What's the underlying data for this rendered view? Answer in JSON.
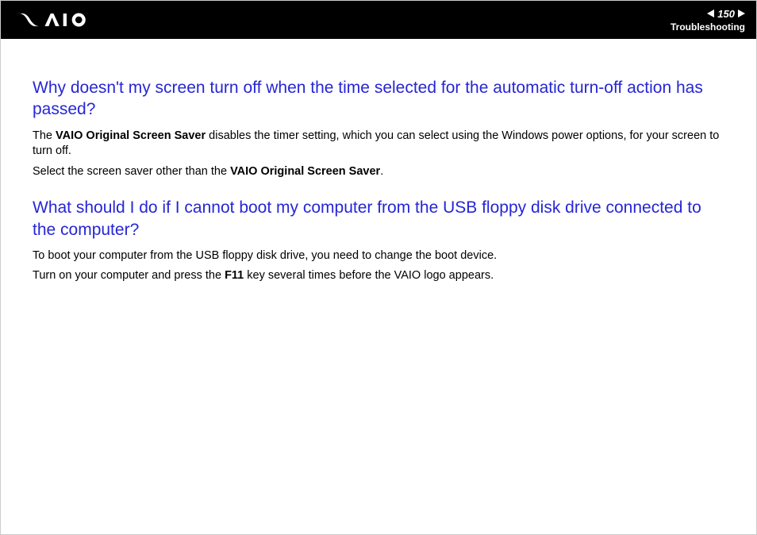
{
  "header": {
    "page_number": "150",
    "section": "Troubleshooting"
  },
  "q1": {
    "title": "Why doesn't my screen turn off when the time selected for the automatic turn-off action has passed?",
    "p1_a": "The ",
    "p1_b": "VAIO Original Screen Saver",
    "p1_c": " disables the timer setting, which you can select using the Windows power options, for your screen to turn off.",
    "p2_a": "Select the screen saver other than the ",
    "p2_b": "VAIO Original Screen Saver",
    "p2_c": "."
  },
  "q2": {
    "title": "What should I do if I cannot boot my computer from the USB floppy disk drive connected to the computer?",
    "p1": "To boot your computer from the USB floppy disk drive, you need to change the boot device.",
    "p2_a": "Turn on your computer and press the ",
    "p2_b": "F11",
    "p2_c": " key several times before the VAIO logo appears."
  }
}
